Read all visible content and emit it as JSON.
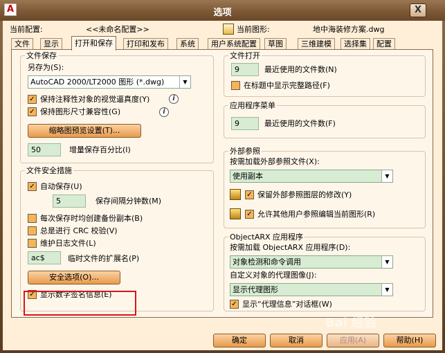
{
  "window": {
    "title": "选项",
    "app_icon": "A",
    "close": "X"
  },
  "info": {
    "current_profile_label": "当前配置:",
    "current_profile_value": "<<未命名配置>>",
    "current_drawing_label": "当前图形:",
    "current_drawing_value": "地中海装修方案.dwg"
  },
  "tabs": [
    "文件",
    "显示",
    "打开和保存",
    "打印和发布",
    "系统",
    "用户系统配置",
    "草图",
    "三维建模",
    "选择集",
    "配置"
  ],
  "active_tab": "打开和保存",
  "file_save": {
    "title": "文件保存",
    "save_as_label": "另存为(S):",
    "save_as_value": "AutoCAD 2000/LT2000 图形 (*.dwg)",
    "keep_annotative_label": "保持注释性对象的视觉逼真度(Y)",
    "keep_drawing_size_label": "保持图形尺寸兼容性(G)",
    "thumbnail_button": "缩略图预览设置(T)...",
    "incremental_value": "50",
    "incremental_label": "增量保存百分比(I)"
  },
  "file_safety": {
    "title": "文件安全措施",
    "autosave_label": "自动保存(U)",
    "minutes_value": "5",
    "minutes_label": "保存间隔分钟数(M)",
    "backup_label": "每次保存时均创建备份副本(B)",
    "crc_label": "总是进行 CRC 校验(V)",
    "log_label": "维护日志文件(L)",
    "temp_ext_value": "ac$",
    "temp_ext_label": "临时文件的扩展名(P)",
    "security_button": "安全选项(O)...",
    "digital_sig_label": "显示数字签名信息(E)"
  },
  "file_open": {
    "title": "文件打开",
    "recent_value": "9",
    "recent_label": "最近使用的文件数(N)",
    "full_path_label": "在标题中显示完整路径(F)"
  },
  "app_menu": {
    "title": "应用程序菜单",
    "recent_value": "9",
    "recent_label": "最近使用的文件数(F)"
  },
  "xref": {
    "title": "外部参照",
    "demand_label": "按需加载外部参照文件(X):",
    "demand_value": "使用副本",
    "retain_label": "保留外部参照图层的修改(Y)",
    "allow_edit_label": "允许其他用户参照编辑当前图形(R)"
  },
  "objectarx": {
    "title": "ObjectARX 应用程序",
    "demand_label": "按需加载 ObjectARX 应用程序(D):",
    "demand_value": "对象检测和命令调用",
    "proxy_label": "自定义对象的代理图像(J):",
    "proxy_value": "显示代理图形",
    "proxy_info_label": "显示“代理信息”对话框(W)"
  },
  "buttons": {
    "ok": "确定",
    "cancel": "取消",
    "apply": "应用(A)",
    "help": "帮助(H)"
  },
  "watermark": "Bai 经验"
}
